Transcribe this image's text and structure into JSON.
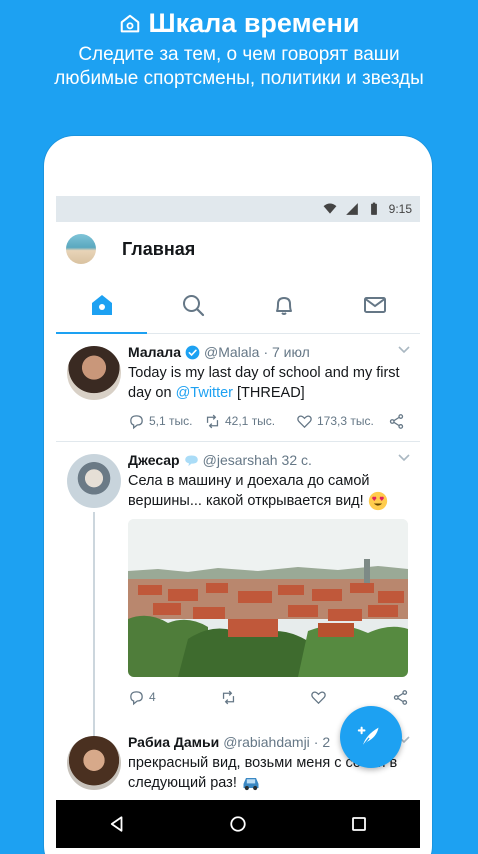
{
  "promo": {
    "title": "Шкала времени",
    "subtitle_line1": "Следите за тем, о чем говорят ваши",
    "subtitle_line2": "любимые спортсмены, политики и звезды",
    "icon": "home-icon"
  },
  "status_bar": {
    "time": "9:15",
    "icons": [
      "wifi-icon",
      "signal-icon",
      "battery-icon"
    ]
  },
  "app_bar": {
    "title": "Главная",
    "avatar": "profile-avatar"
  },
  "tabs": [
    {
      "name": "home",
      "icon": "home-icon",
      "active": true
    },
    {
      "name": "search",
      "icon": "search-icon",
      "active": false
    },
    {
      "name": "notifications",
      "icon": "bell-icon",
      "active": false
    },
    {
      "name": "messages",
      "icon": "mail-icon",
      "active": false
    }
  ],
  "tweets": [
    {
      "name": "Малала",
      "verified": true,
      "handle": "@Malala",
      "time": "· 7 июл",
      "text_before": "Today is my last day of school and my first day on ",
      "mention": "@Twitter",
      "text_after": " [THREAD]",
      "replies": "5,1 тыс.",
      "retweets": "42,1 тыс.",
      "likes": "173,3 тыс."
    },
    {
      "name": "Джесар",
      "handle": "@jesarshah",
      "time": "32 с.",
      "text": "Села в машину и доехала до самой вершины... какой открывается вид!",
      "emoji": "heart-eyes-emoji",
      "replies": "4",
      "retweets": "",
      "likes": ""
    },
    {
      "name": "Рабиа Дамьи",
      "handle": "@rabiahdamji",
      "time": "· 2",
      "text": "прекрасный вид, возьми меня с собой в следующий раз!",
      "emoji": "car-emoji"
    }
  ],
  "fab": {
    "icon": "compose-icon"
  },
  "nav_bar": {
    "icons": [
      "back-icon",
      "home-circle-icon",
      "recents-icon"
    ]
  },
  "colors": {
    "accent": "#1da1f2",
    "text": "#14171a",
    "secondary": "#657786",
    "divider": "#e1e8ed"
  }
}
